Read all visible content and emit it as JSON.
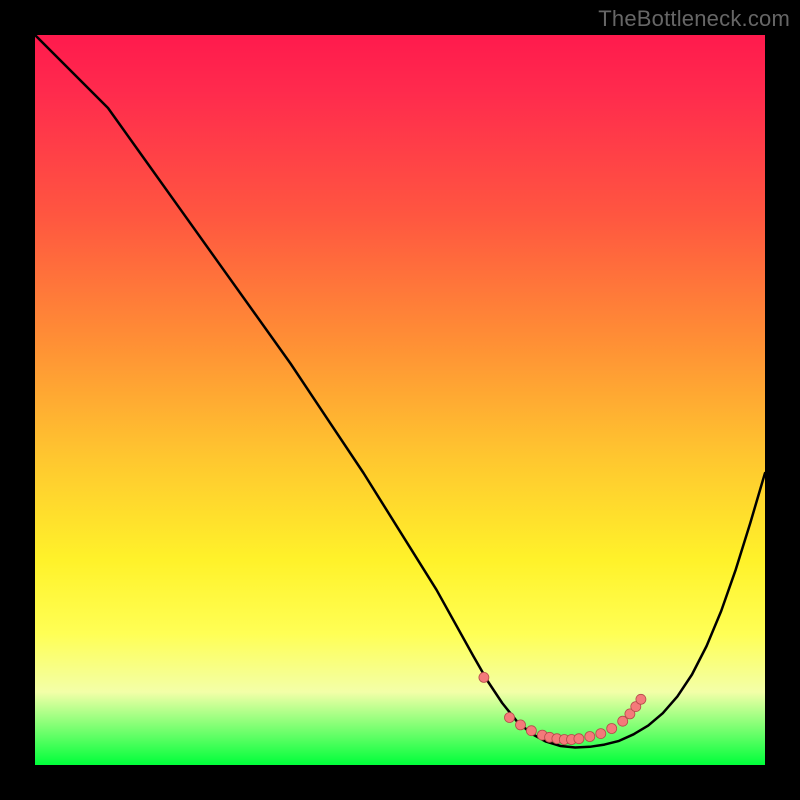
{
  "watermark": "TheBottleneck.com",
  "colors": {
    "background": "#000000",
    "curve": "#000000",
    "markers": "#f47a7a",
    "gradient_stops": [
      "#ff1a4d",
      "#ff2b4d",
      "#ff5740",
      "#ff8f35",
      "#ffc72f",
      "#fff22a",
      "#ffff55",
      "#f3ffa8",
      "#00ff3a"
    ]
  },
  "chart_data": {
    "type": "line",
    "xlim": [
      0,
      100
    ],
    "ylim": [
      0,
      100
    ],
    "title": "",
    "xlabel": "",
    "ylabel": "",
    "comment": "x is normalized horizontal position (0=left edge of plot, 100=right). y is normalized vertical position from bottom (0=bottom, 100=top). No axis ticks or labels are visible; values are read off the pixel grid.",
    "series": [
      {
        "name": "curve",
        "x": [
          0,
          5,
          10,
          15,
          20,
          25,
          30,
          35,
          40,
          45,
          50,
          55,
          60,
          62,
          64,
          66,
          68,
          70,
          72,
          74,
          76,
          78,
          80,
          82,
          84,
          86,
          88,
          90,
          92,
          94,
          96,
          98,
          100
        ],
        "y": [
          100,
          95,
          90,
          83,
          76,
          69,
          62,
          55,
          47.5,
          40,
          32,
          24,
          15,
          11.5,
          8.5,
          6.0,
          4.3,
          3.2,
          2.6,
          2.4,
          2.5,
          2.8,
          3.3,
          4.2,
          5.4,
          7.1,
          9.4,
          12.4,
          16.3,
          21.1,
          26.8,
          33.2,
          40.0
        ]
      },
      {
        "name": "markers",
        "comment": "salmon dots clustered near the valley bottom",
        "x": [
          61.5,
          65.0,
          66.5,
          68.0,
          69.5,
          70.5,
          71.5,
          72.5,
          73.5,
          74.5,
          76.0,
          77.5,
          79.0,
          80.5,
          81.5,
          82.3,
          83.0
        ],
        "y": [
          12.0,
          6.5,
          5.5,
          4.7,
          4.1,
          3.8,
          3.6,
          3.5,
          3.5,
          3.6,
          3.9,
          4.3,
          5.0,
          6.0,
          7.0,
          8.0,
          9.0
        ]
      }
    ],
    "minima": {
      "x": 73.5,
      "y": 2.4
    }
  }
}
